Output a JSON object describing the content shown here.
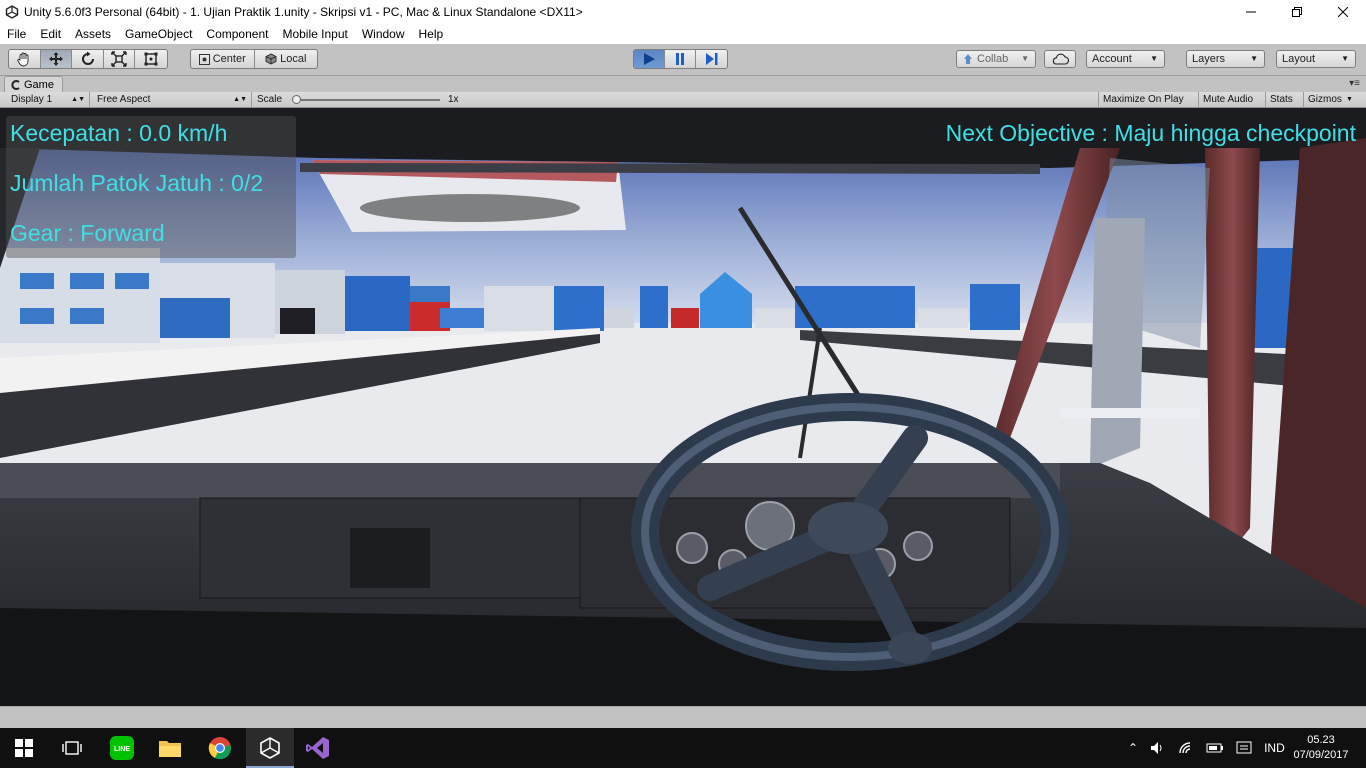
{
  "window": {
    "title": "Unity 5.6.0f3 Personal (64bit) - 1. Ujian Praktik 1.unity - Skripsi v1 - PC, Mac & Linux Standalone <DX11>",
    "minimize_icon": "minimize-icon",
    "maximize_icon": "restore-icon",
    "close_icon": "close-icon"
  },
  "menu": {
    "items": [
      "File",
      "Edit",
      "Assets",
      "GameObject",
      "Component",
      "Mobile Input",
      "Window",
      "Help"
    ]
  },
  "toolbar": {
    "tools": [
      "hand-tool-icon",
      "move-tool-icon",
      "rotate-tool-icon",
      "scale-tool-icon",
      "rect-tool-icon"
    ],
    "pivot_label": "Center",
    "space_label": "Local",
    "collab_label": "Collab",
    "account_label": "Account",
    "layers_label": "Layers",
    "layout_label": "Layout",
    "play_state": "playing"
  },
  "game_tab": {
    "label": "Game",
    "display": "Display 1",
    "aspect": "Free Aspect",
    "scale_label": "Scale",
    "scale_value": "1x",
    "toggles": [
      "Maximize On Play",
      "Mute Audio",
      "Stats",
      "Gizmos"
    ]
  },
  "hud": {
    "speed": "Kecepatan : 0.0 km/h",
    "poles": "Jumlah Patok Jatuh : 0/2",
    "gear": "Gear : Forward",
    "objective": "Next Objective : Maju hingga checkpoint",
    "text_color": "#3ee0e6"
  },
  "taskbar": {
    "apps": [
      "windows-start-icon",
      "task-view-icon",
      "line-app-icon",
      "file-explorer-icon",
      "chrome-icon",
      "unity-icon",
      "visual-studio-icon"
    ],
    "language": "IND",
    "time": "05.23",
    "date": "07/09/2017"
  },
  "colors": {
    "editor_bg": "#c2c2c2",
    "play_active": "#5b86c2",
    "taskbar": "#101010"
  }
}
